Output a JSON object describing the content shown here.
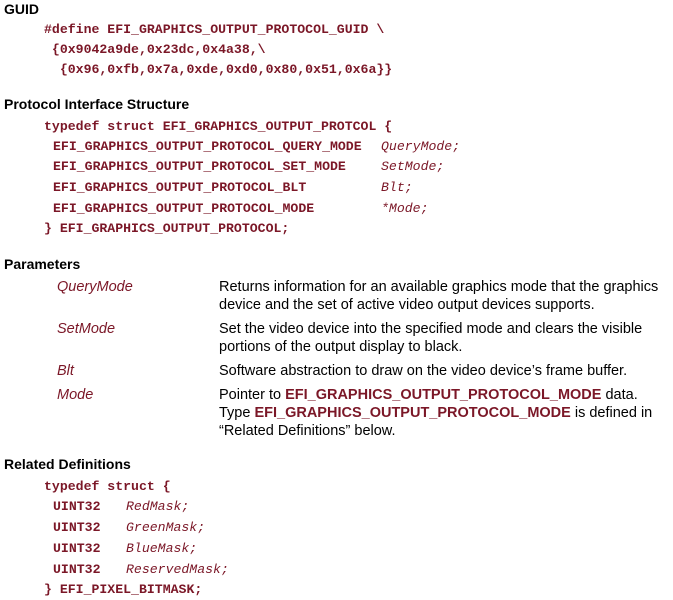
{
  "guid": {
    "heading": "GUID",
    "lines": [
      "#define EFI_GRAPHICS_OUTPUT_PROTOCOL_GUID \\",
      " {0x9042a9de,0x23dc,0x4a38,\\",
      "  {0x96,0xfb,0x7a,0xde,0xd0,0x80,0x51,0x6a}}"
    ]
  },
  "protocol": {
    "heading": "Protocol Interface Structure",
    "open": "typedef struct EFI_GRAPHICS_OUTPUT_PROTCOL {",
    "members": [
      {
        "type": "EFI_GRAPHICS_OUTPUT_PROTOCOL_QUERY_MODE",
        "name": "QueryMode;"
      },
      {
        "type": "EFI_GRAPHICS_OUTPUT_PROTOCOL_SET_MODE",
        "name": "SetMode;"
      },
      {
        "type": "EFI_GRAPHICS_OUTPUT_PROTOCOL_BLT",
        "name": "Blt;"
      },
      {
        "type": "EFI_GRAPHICS_OUTPUT_PROTOCOL_MODE",
        "name": "*Mode;"
      }
    ],
    "close": "} EFI_GRAPHICS_OUTPUT_PROTOCOL;"
  },
  "parameters": {
    "heading": "Parameters",
    "items": [
      {
        "name": "QueryMode",
        "desc": "Returns information for an available graphics mode that the graphics device and the set of active video output devices supports."
      },
      {
        "name": "SetMode",
        "desc": "Set the video device into the specified mode and clears the visible portions of the output display to black."
      },
      {
        "name": "Blt",
        "desc": "Software abstraction to draw on the video device’s frame buffer."
      },
      {
        "name": "Mode",
        "desc_parts": {
          "p1": "Pointer to ",
          "ref1": "EFI_GRAPHICS_OUTPUT_PROTOCOL_MODE",
          "p2": " data. Type ",
          "ref2": "EFI_GRAPHICS_OUTPUT_PROTOCOL_MODE",
          "p3": " is defined in “Related Definitions” below."
        }
      }
    ]
  },
  "related": {
    "heading": "Related Definitions",
    "open": "typedef struct {",
    "members": [
      {
        "type": "UINT32",
        "name": "RedMask;"
      },
      {
        "type": "UINT32",
        "name": "GreenMask;"
      },
      {
        "type": "UINT32",
        "name": "BlueMask;"
      },
      {
        "type": "UINT32",
        "name": "ReservedMask;"
      }
    ],
    "close": "} EFI_PIXEL_BITMASK;"
  }
}
